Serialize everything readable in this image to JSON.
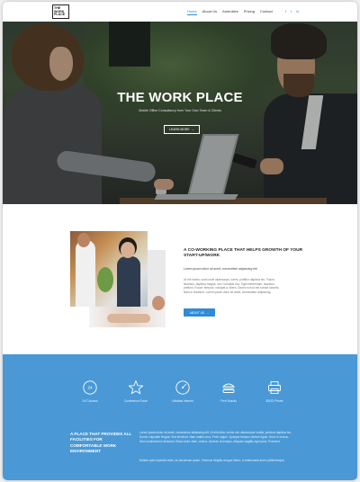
{
  "nav": {
    "logo_lines": [
      "THE",
      "WORK",
      "PLACE"
    ],
    "links": [
      {
        "label": "Home",
        "active": true
      },
      {
        "label": "About Us",
        "active": false
      },
      {
        "label": "Amenities",
        "active": false
      },
      {
        "label": "Pricing",
        "active": false
      },
      {
        "label": "Contact",
        "active": false
      }
    ],
    "socials": [
      "f",
      "t",
      "in"
    ]
  },
  "hero": {
    "title": "THE WORK PLACE",
    "subtitle": "Mobile Office Consultancy from Your Own Team & Clients",
    "button_label": "LEARN MORE",
    "button_arrow": "→"
  },
  "about": {
    "title": "A CO-WORKING PLACE THAT HELPS GROWTH OF YOUR START-UP/WORK",
    "subtitle": "Lorem ipsum dolor sit amet, consectetur adipiscing elit",
    "body": "Ut eni minim, sunt curve ullamcorpe, lorem, porttitor dapibus leo. Fusce, faucibus, dapibus magna, nec Convallis Gur. Eget elementum, faucibus, pretium. Fusce, tempus, volutpat a, libero. Donec non id est rutrum lobortis. Nam in tincidunt. Lorem ipsum dolor sit amet, consectetur adipiscing.",
    "button_label": "ABOUT US",
    "button_arrow": "→"
  },
  "features": {
    "items": [
      {
        "icon": "clock-24-icon",
        "label": "24/7 Access"
      },
      {
        "icon": "star-icon",
        "label": "Conference Room"
      },
      {
        "icon": "gauge-icon",
        "label": "Ultrafast Internet"
      },
      {
        "icon": "burger-icon",
        "label": "Free Snacks"
      },
      {
        "icon": "printer-icon",
        "label": "3D/2D Printer"
      }
    ],
    "bottom_title": "A PLACE THAT PROVIDES ALL FACILITIES FOR COMFORTABLE WORK ENVIRONMENT",
    "bottom_body": "Lorem ipsum dolor sit amet, consectetur adipiscing elit. Ut elit tellus, luctus nec ullamcorper mattis, pulvinar dapibus leo. Donec vulputate feugiat. Sed tincidunt. Nam mattis urna. Proin augue. Quisque tempus ultrices ligula. Nunc in cursus. Sed condimentum tincidunt. Etiam dolor vitae, viverra. Aenean ut tempus. Aliquam sagittis eget justo. Praesent.",
    "bottom_body2": "Nullam quis imperdiet ante, ac accumsan quam. Vivamus fringilla congue libero, in malesuada lorem pellentesque."
  },
  "colors": {
    "accent": "#2f8bd6",
    "feature_band": "#4a99d6"
  }
}
